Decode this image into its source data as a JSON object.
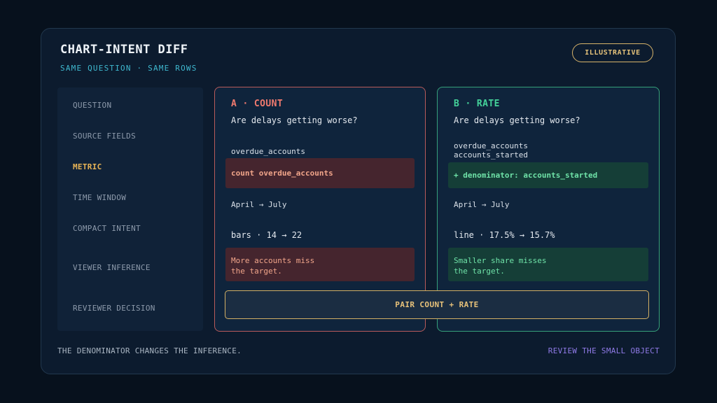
{
  "header": {
    "title": "CHART-INTENT DIFF",
    "subtitle": "SAME QUESTION · SAME ROWS",
    "badge": "ILLUSTRATIVE"
  },
  "rows": [
    {
      "label": "QUESTION",
      "active": false
    },
    {
      "label": "SOURCE FIELDS",
      "active": false
    },
    {
      "label": "METRIC",
      "active": true
    },
    {
      "label": "TIME WINDOW",
      "active": false
    },
    {
      "label": "COMPACT INTENT",
      "active": false
    },
    {
      "label": "VIEWER INFERENCE",
      "active": false
    },
    {
      "label": "REVIEWER DECISION",
      "active": false
    }
  ],
  "panel_a": {
    "heading": "A · COUNT",
    "question": "Are delays getting worse?",
    "fields": "overdue_accounts",
    "metric": "count overdue_accounts",
    "window": "April → July",
    "intent": "bars · 14 → 22",
    "inference": "More accounts miss\nthe target.",
    "accent": "#f07a6f"
  },
  "panel_b": {
    "heading": "B · RATE",
    "question": "Are delays getting worse?",
    "fields": "overdue_accounts\naccounts_started",
    "metric": "+ denominator: accounts_started",
    "window": "April → July",
    "intent": "line · 17.5% → 15.7%",
    "inference": "Smaller share misses\nthe target.",
    "accent": "#44d29a"
  },
  "decision": "PAIR COUNT + RATE",
  "footer": {
    "left": "THE DENOMINATOR CHANGES THE INFERENCE.",
    "right": "REVIEW THE SMALL OBJECT"
  }
}
